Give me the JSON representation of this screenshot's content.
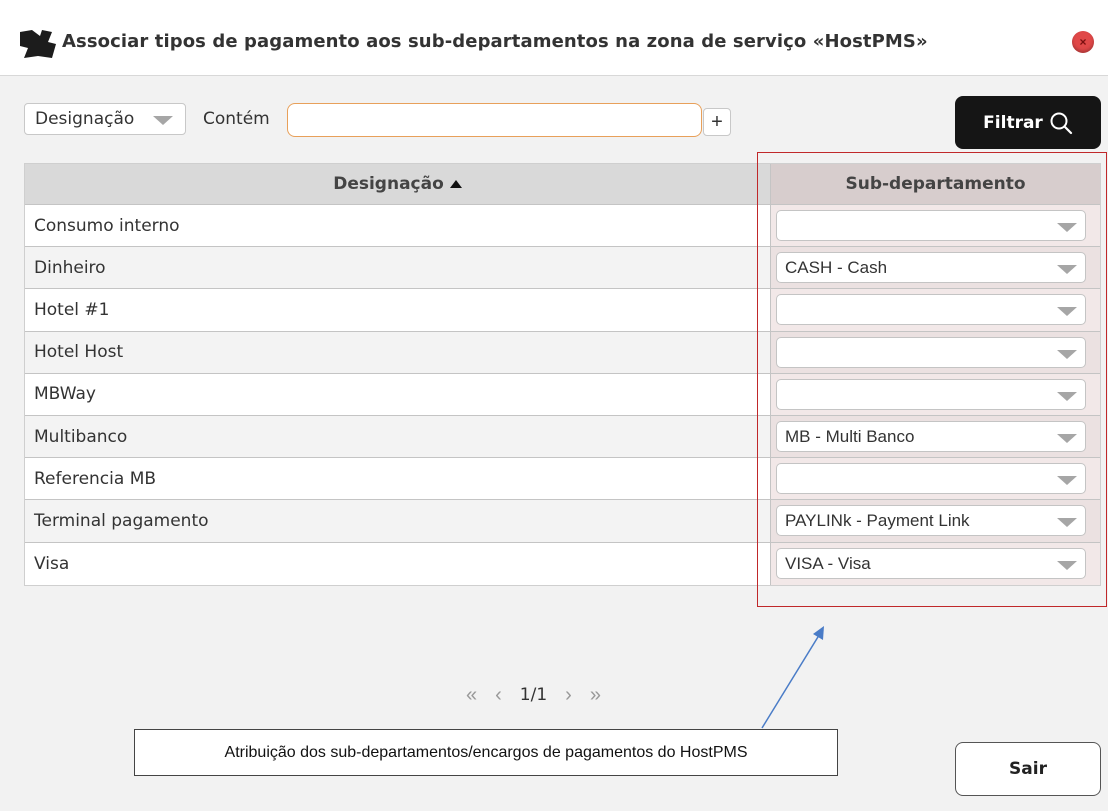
{
  "window": {
    "title": "Associar tipos de pagamento aos sub-departamentos na zona de serviço «HostPMS»",
    "close_glyph": "×",
    "app_icon": "printer-icon"
  },
  "filter": {
    "field": "Designação",
    "operator_label": "Contém",
    "search_value": "",
    "add_glyph": "+",
    "filter_button": "Filtrar"
  },
  "grid": {
    "columns": [
      "Designação",
      "Sub-departamento"
    ],
    "rows": [
      {
        "designacao": "Consumo interno",
        "sub_departamento": ""
      },
      {
        "designacao": "Dinheiro",
        "sub_departamento": "CASH - Cash"
      },
      {
        "designacao": "Hotel #1",
        "sub_departamento": ""
      },
      {
        "designacao": "Hotel Host",
        "sub_departamento": ""
      },
      {
        "designacao": "MBWay",
        "sub_departamento": ""
      },
      {
        "designacao": "Multibanco",
        "sub_departamento": "MB - Multi Banco"
      },
      {
        "designacao": "Referencia MB",
        "sub_departamento": ""
      },
      {
        "designacao": "Terminal pagamento",
        "sub_departamento": "PAYLINk - Payment Link"
      },
      {
        "designacao": "Visa",
        "sub_departamento": "VISA - Visa"
      }
    ]
  },
  "pagination": {
    "first": "«",
    "prev": "‹",
    "pages": "1/1",
    "next": "›",
    "last": "»"
  },
  "annotation": {
    "text": "Atribuição dos sub-departamentos/encargos de pagamentos do HostPMS"
  },
  "footer": {
    "exit_button": "Sair"
  },
  "colors": {
    "highlight": "#c0282a",
    "arrow": "#4a7cc7",
    "filter_button_bg": "#151515"
  }
}
